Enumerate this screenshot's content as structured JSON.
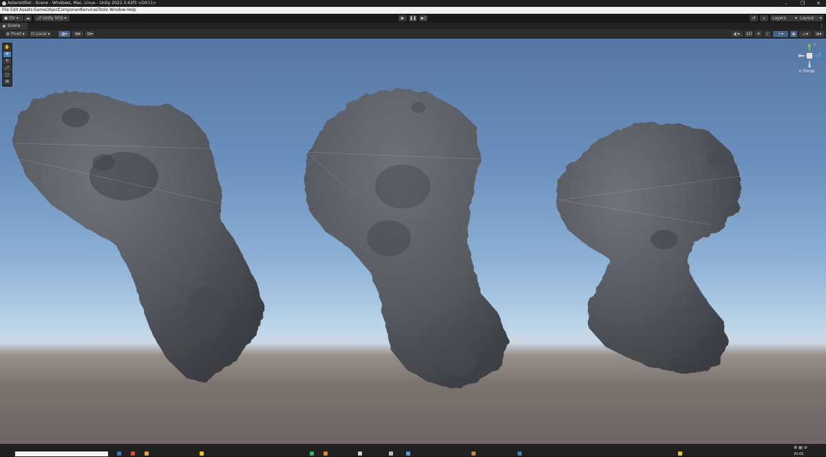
{
  "window": {
    "title": "AsteroidSet - Scene - Windows, Mac, Linux - Unity 2022.3.62f3 <DX11>"
  },
  "menu": [
    "File",
    "Edit",
    "Assets",
    "GameObject",
    "Component",
    "Services",
    "Tools",
    "Window",
    "Help"
  ],
  "toolbar": {
    "account": "OV",
    "vcs": "Unity VCS",
    "layers": "Layers",
    "layout": "Layout"
  },
  "tab": {
    "label": "Scene"
  },
  "scene_options": {
    "pivot": "Pivot",
    "local": "Local",
    "mode_2d": "2D"
  },
  "gizmo": {
    "persp": "< Persp",
    "x": "x",
    "y": "y",
    "z": "z"
  },
  "taskbar": {
    "time": "20:01"
  },
  "colors": {
    "sky_top": "#5677a3",
    "horizon": "#cbd9e6",
    "ground": "#6d6564",
    "rock": "#55585e",
    "accent": "#4c7fbf"
  }
}
